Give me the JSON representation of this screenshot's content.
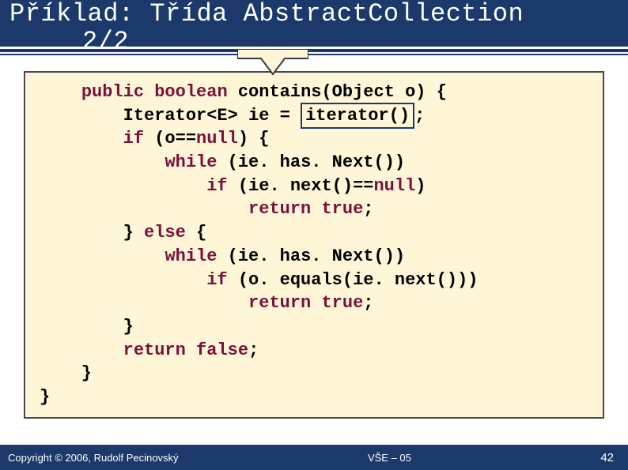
{
  "header": {
    "title_line1": "Příklad: Třída AbstractCollection",
    "title_line2": "2/2"
  },
  "code": {
    "l1_pre": "    ",
    "l1_kw1": "public",
    "l1_mid1": " ",
    "l1_kw2": "boolean",
    "l1_mid2": " contains(Object o) {",
    "l2_pre": "        Iterator<E> ie = ",
    "l2_hl": "iterator()",
    "l2_post": ";",
    "l3_pre": "        ",
    "l3_kw": "if",
    "l3_mid": " (o==",
    "l3_kw2": "null",
    "l3_post": ") {",
    "l4_pre": "            ",
    "l4_kw": "while",
    "l4_post": " (ie. has. Next())",
    "l5_pre": "                ",
    "l5_kw": "if",
    "l5_mid": " (ie. next()==",
    "l5_kw2": "null",
    "l5_post": ")",
    "l6_pre": "                    ",
    "l6_kw": "return",
    "l6_mid": " ",
    "l6_kw2": "true",
    "l6_post": ";",
    "l7_pre": "        } ",
    "l7_kw": "else",
    "l7_post": " {",
    "l8_pre": "            ",
    "l8_kw": "while",
    "l8_post": " (ie. has. Next())",
    "l9_pre": "                ",
    "l9_kw": "if",
    "l9_post": " (o. equals(ie. next()))",
    "l10_pre": "                    ",
    "l10_kw": "return",
    "l10_mid": " ",
    "l10_kw2": "true",
    "l10_post": ";",
    "l11": "        }",
    "l12_pre": "        ",
    "l12_kw": "return",
    "l12_mid": " ",
    "l12_kw2": "false",
    "l12_post": ";",
    "l13": "    }",
    "l14": "}"
  },
  "footer": {
    "copyright": "Copyright © 2006, Rudolf Pecinovský",
    "center": "VŠE – 05",
    "page": "42"
  }
}
